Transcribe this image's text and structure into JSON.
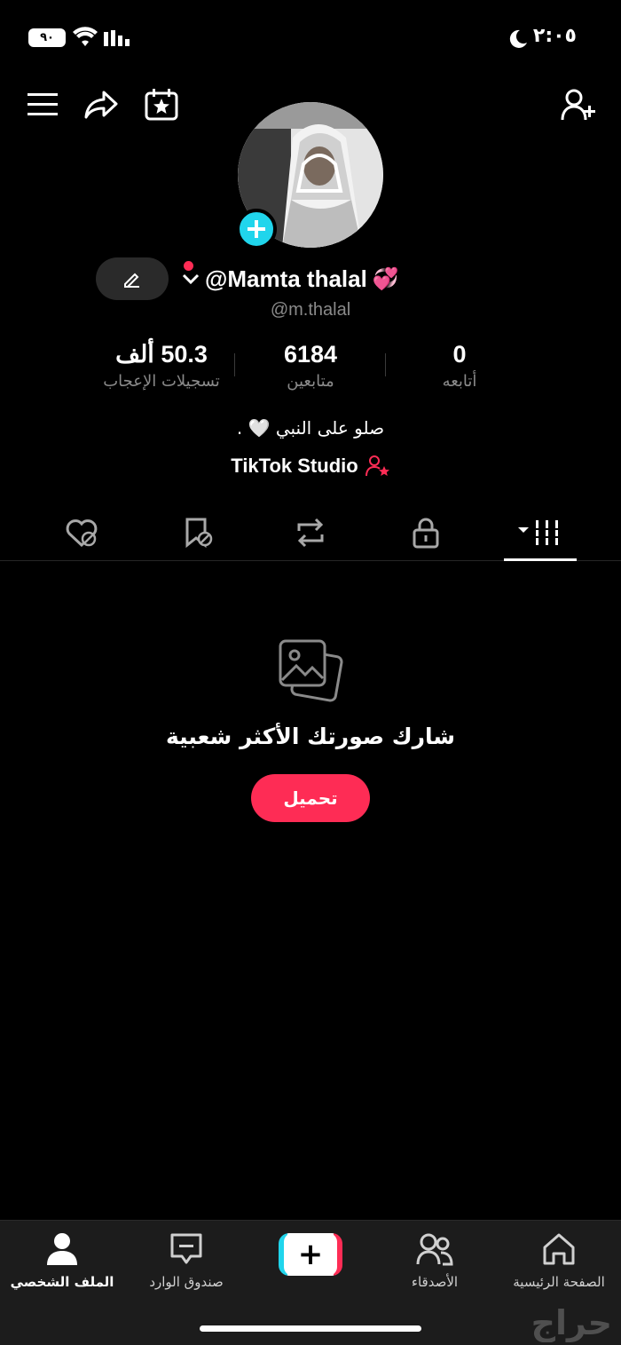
{
  "status_bar": {
    "battery": "٩٠",
    "time": "٢:٠٥"
  },
  "profile": {
    "display_name": "@Mamta thalal",
    "name_emoji": "💞",
    "handle": "@m.thalal",
    "stats": [
      {
        "value": "50.3 ألف",
        "label": "تسجيلات الإعجاب"
      },
      {
        "value": "6184",
        "label": "متابعين"
      },
      {
        "value": "0",
        "label": "أتابعه"
      }
    ],
    "bio": "صلو على النبي 🤍 .",
    "studio_link": "TikTok Studio"
  },
  "empty_state": {
    "title": "شارك صورتك الأكثر شعبية",
    "button": "تحميل"
  },
  "bottom_nav": {
    "profile": "الملف الشخصي",
    "inbox": "صندوق الوارد",
    "create": "+",
    "friends": "الأصدقاء",
    "home": "الصفحة الرئيسية"
  },
  "watermark": "حراج",
  "colors": {
    "accent": "#fe2c55",
    "cyan": "#20d5ec",
    "background": "#000000"
  }
}
